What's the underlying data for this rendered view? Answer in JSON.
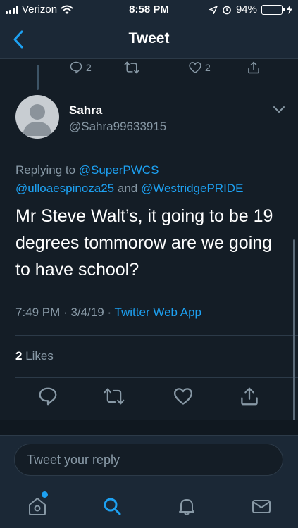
{
  "status_bar": {
    "carrier": "Verizon",
    "time": "8:58 PM",
    "battery_percent": "94%",
    "battery_level": 0.94
  },
  "nav": {
    "title": "Tweet",
    "back_icon": "chevron-left-icon"
  },
  "parent_tweet_actions": {
    "reply_count": "2",
    "like_count": "2"
  },
  "tweet": {
    "display_name": "Sahra",
    "handle": "@Sahra99633915",
    "replying_prefix": "Replying to",
    "mention_1": "@SuperPWCS",
    "mention_2": "@ulloaespinoza25",
    "and_word": "and",
    "mention_3": "@WestridgePRIDE",
    "text": "Mr Steve Walt’s, it going to be 19 degrees tommorow are we going to have school?",
    "time": "7:49 PM",
    "date": "3/4/19",
    "separator": "·",
    "source": "Twitter Web App",
    "likes_count": "2",
    "likes_label": "Likes"
  },
  "reply": {
    "placeholder": "Tweet your reply"
  },
  "colors": {
    "background": "#141d26",
    "bar": "#1b2836",
    "accent": "#1da1f2",
    "muted": "#8899a6"
  }
}
